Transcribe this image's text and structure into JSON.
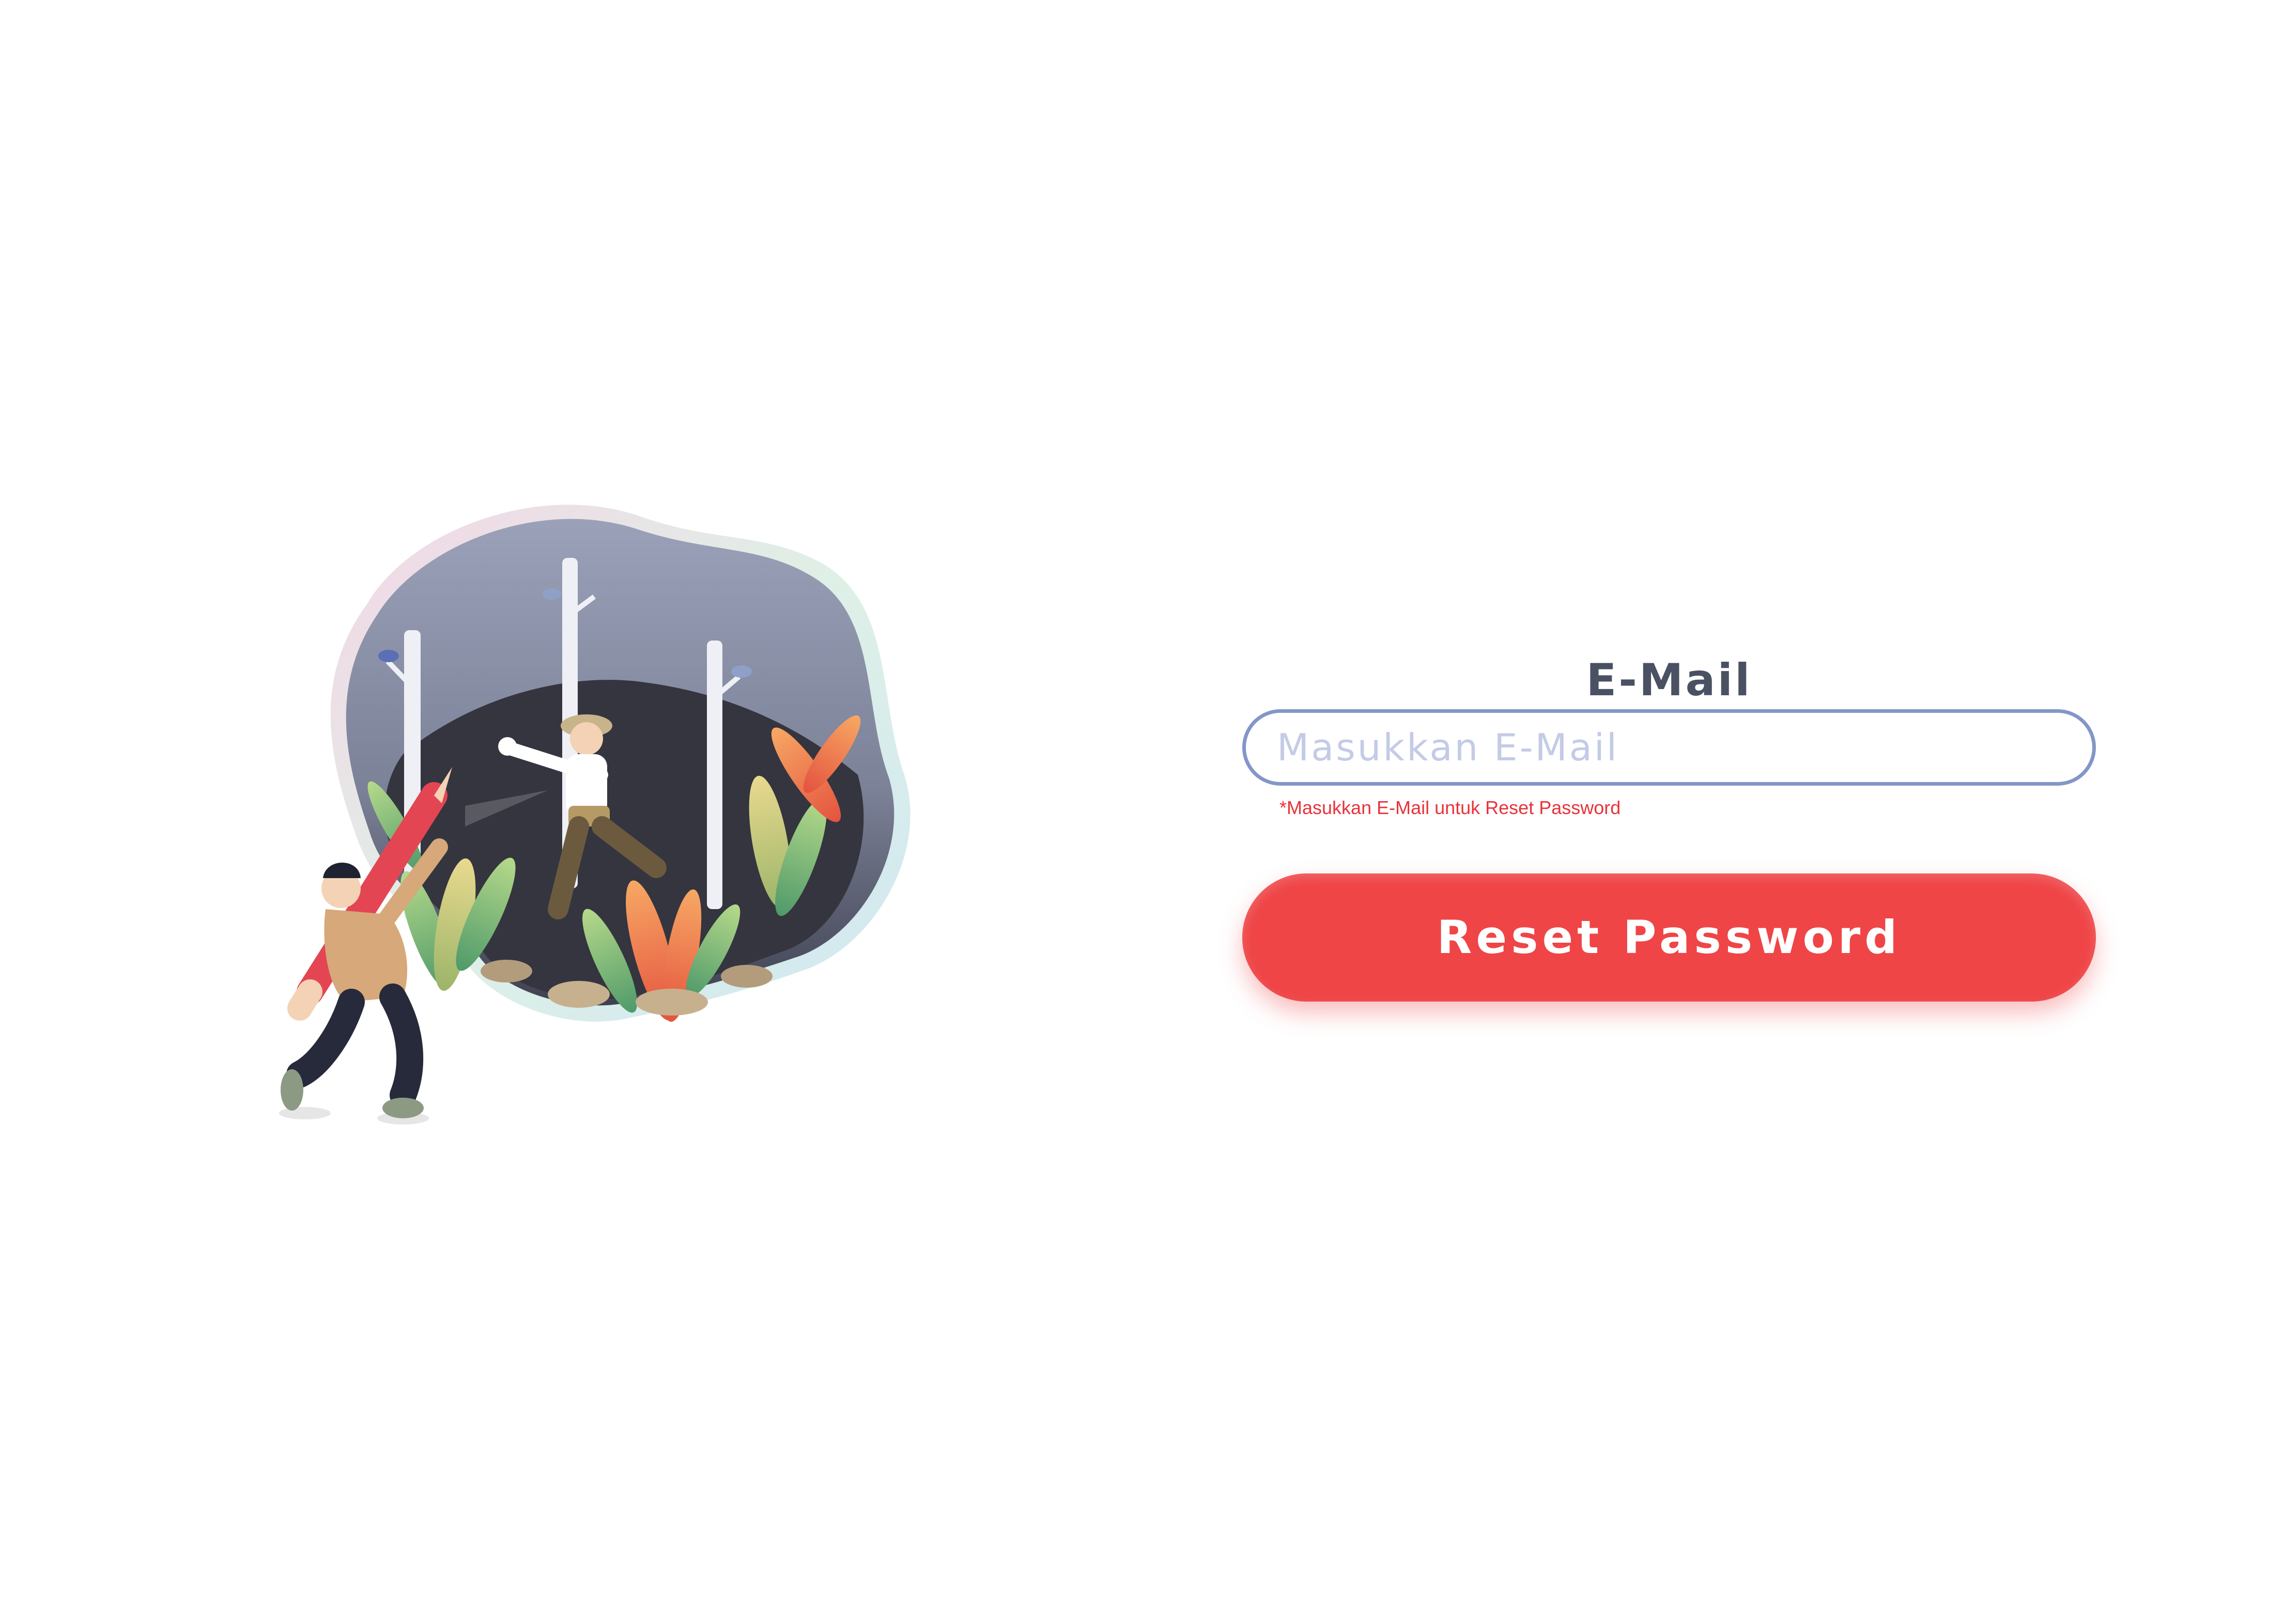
{
  "form": {
    "email_label": "E-Mail",
    "email_value": "",
    "email_placeholder": "Masukkan E-Mail",
    "email_hint": "*Masukkan E-Mail untuk Reset Password",
    "reset_button_label": "Reset Password"
  },
  "colors": {
    "accent": "#ef4547",
    "input_border": "#8496c8",
    "label_text": "#4a5163",
    "placeholder_text": "#c4cbe6",
    "hint_text": "#e8333a"
  },
  "illustration": {
    "icon": "forest-explorer-illustration"
  }
}
